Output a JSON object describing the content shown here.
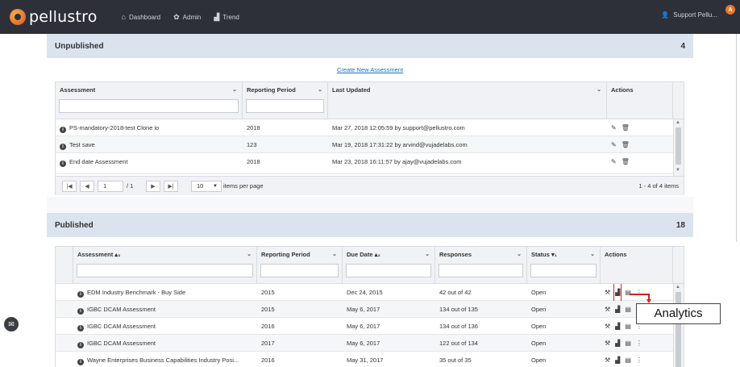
{
  "app": {
    "logo_text": "pellustro",
    "nav": [
      {
        "label": "Dashboard",
        "icon": "dashboard-icon"
      },
      {
        "label": "Admin",
        "icon": "gear-icon"
      },
      {
        "label": "Trend",
        "icon": "bar-chart-icon"
      }
    ],
    "user": "Support Pellu...",
    "notification_badge": "A"
  },
  "unpublished": {
    "title": "Unpublished",
    "count": "4",
    "create_link": "Create New Assessment",
    "columns": [
      "Assessment",
      "Reporting Period",
      "Last Updated",
      "Actions"
    ],
    "rows": [
      {
        "assessment": "PS-mandatory-2018-test Clone io",
        "period": "2018",
        "updated": "Mar 27, 2018 12:05:59 by support@pellustro.com"
      },
      {
        "assessment": "Test save",
        "period": "123",
        "updated": "Mar 19, 2018 17:31:22 by arvind@vujadelabs.com"
      },
      {
        "assessment": "End date Assessment",
        "period": "2018",
        "updated": "Mar 23, 2018 16:11:57 by ajay@vujadelabs.com"
      }
    ],
    "pager": {
      "page": "1",
      "of_pages": "/ 1",
      "page_size": "10",
      "items_per_page": "items per page",
      "summary": "1 - 4 of 4 items"
    }
  },
  "published": {
    "title": "Published",
    "count": "18",
    "columns": [
      "Assessment ▴₃",
      "Reporting Period",
      "Due Date ▴₂",
      "Responses",
      "Status ▾₁",
      "Actions"
    ],
    "rows": [
      {
        "assessment": "EDM Industry Benchmark - Buy Side",
        "period": "2015",
        "due": "Dec 24, 2015",
        "responses": "42 out of 42",
        "status": "Open"
      },
      {
        "assessment": "IGBC DCAM Assessment",
        "period": "2015",
        "due": "May 6, 2017",
        "responses": "134 out of 135",
        "status": "Open"
      },
      {
        "assessment": "IGBC DCAM Assessment",
        "period": "2016",
        "due": "May 6, 2017",
        "responses": "134 out of 136",
        "status": "Open"
      },
      {
        "assessment": "IGBC DCAM Assessment",
        "period": "2017",
        "due": "May 6, 2017",
        "responses": "122 out of 134",
        "status": "Open"
      },
      {
        "assessment": "Wayne Enterprises Business Capabilities Industry Posi...",
        "period": "2016",
        "due": "May 31, 2017",
        "responses": "35 out of 35",
        "status": "Open"
      }
    ]
  },
  "callout": {
    "label": "Analytics"
  }
}
